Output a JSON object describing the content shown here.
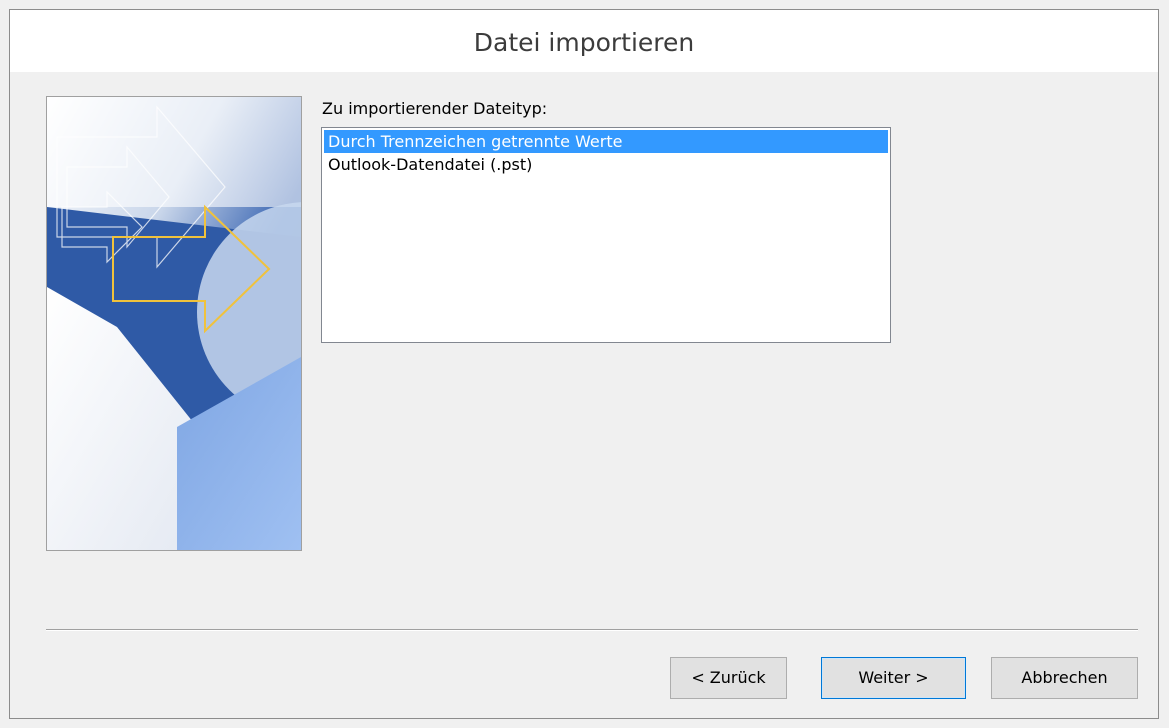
{
  "dialog": {
    "title": "Datei importieren"
  },
  "file_type": {
    "label": "Zu importierender Dateityp:",
    "options": [
      "Durch Trennzeichen getrennte Werte",
      "Outlook-Datendatei (.pst)"
    ],
    "selected": "Durch Trennzeichen getrennte Werte"
  },
  "buttons": {
    "back": "< Zurück",
    "next": "Weiter >",
    "cancel": "Abbrechen"
  },
  "colors": {
    "selection": "#3399ff",
    "banner_blue": "#2e5aa8",
    "arrow_outline": "#f0c23c",
    "default_button_border": "#0078d7"
  },
  "icons": {
    "banner": "import-arrows-illustration"
  }
}
